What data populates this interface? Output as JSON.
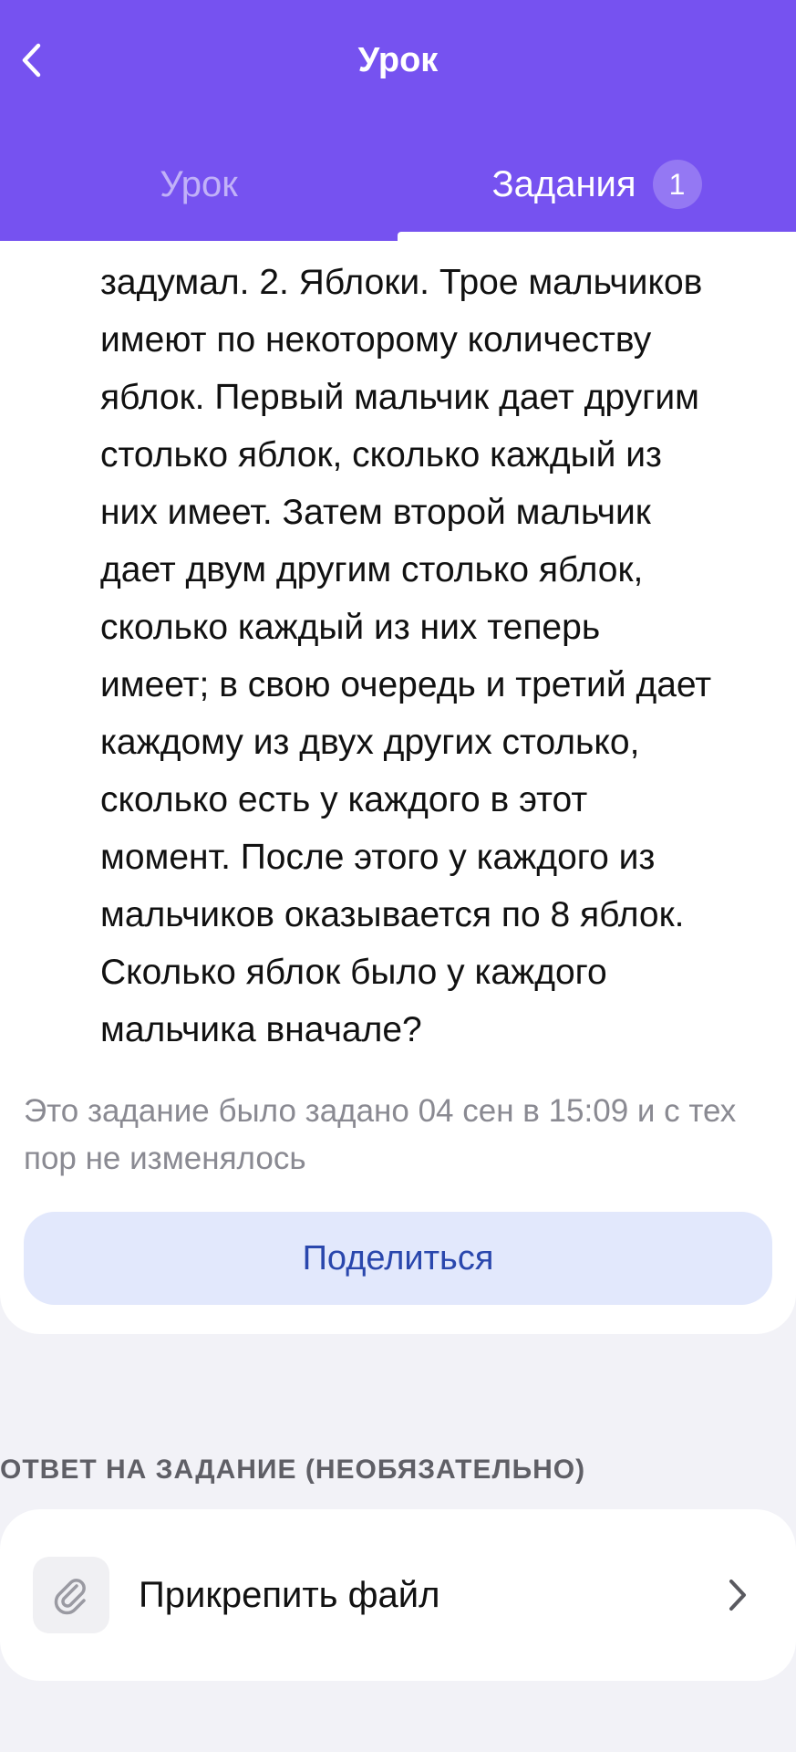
{
  "header": {
    "title": "Урок",
    "back_icon": "chevron-left-icon",
    "background": "#7652f0"
  },
  "tabs": [
    {
      "label": "Урок",
      "active": false
    },
    {
      "label": "Задания",
      "badge": "1",
      "active": true
    }
  ],
  "task": {
    "text": "задумал.  2. Яблоки. Трое мальчиков\nимеют по некоторому количеству\nяблок. Первый мальчик дает другим\nстолько яблок, сколько каждый из\nних имеет. Затем второй мальчик\nдает двум другим столько яблок,\nсколько каждый из них теперь\nимеет; в свою очередь и третий дает\nкаждому из двух других столько,\nсколько есть у каждого в этот\nмомент. После этого у каждого из\nмальчиков оказывается по 8 яблок.\nСколько яблок было у каждого\nмальчика вначале?",
    "assigned_note": "Это задание было задано 04 сен в 15:09 и с тех пор не изменялось",
    "share_label": "Поделиться"
  },
  "answer": {
    "section_label": "ОТВЕТ НА ЗАДАНИЕ (НЕОБЯЗАТЕЛЬНО)",
    "attach_label": "Прикрепить файл",
    "attach_icon": "paperclip-icon",
    "chevron_icon": "chevron-right-icon"
  },
  "colors": {
    "accent": "#7652f0",
    "share_bg": "#e2e8fc",
    "share_text": "#2a47ad",
    "page_bg": "#f2f2f7"
  }
}
